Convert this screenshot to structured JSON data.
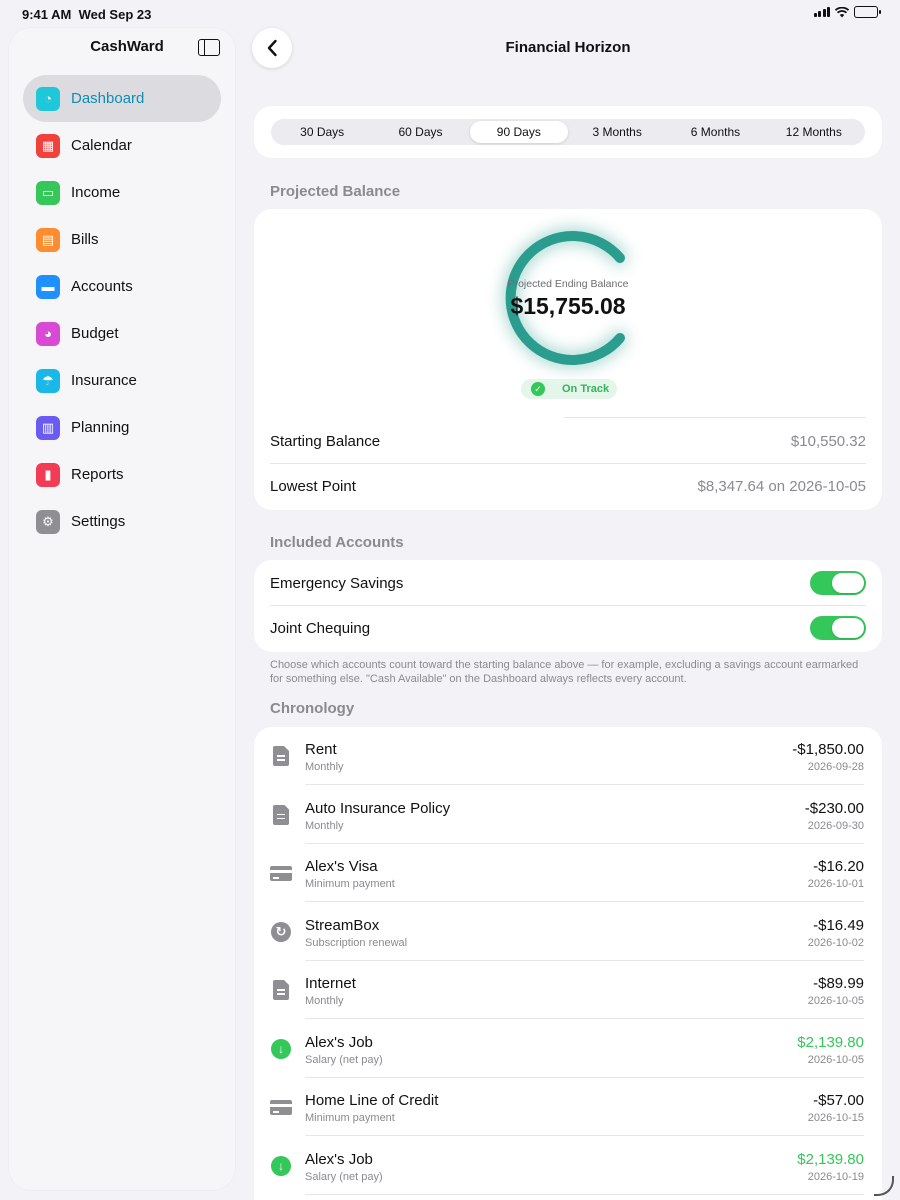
{
  "status_bar": {
    "time": "9:41 AM",
    "date": "Wed Sep 23"
  },
  "sidebar": {
    "title": "CashWard",
    "items": [
      {
        "label": "Dashboard",
        "icon": "gauge-icon",
        "color": "#1ec8d8",
        "active": true
      },
      {
        "label": "Calendar",
        "icon": "calendar-icon",
        "color": "#f2413d"
      },
      {
        "label": "Income",
        "icon": "money-icon",
        "color": "#35c75a"
      },
      {
        "label": "Bills",
        "icon": "document-icon",
        "color": "#ff8c2e"
      },
      {
        "label": "Accounts",
        "icon": "credit-card-icon",
        "color": "#1e90ff"
      },
      {
        "label": "Budget",
        "icon": "pie-chart-icon",
        "color": "#d94ad4"
      },
      {
        "label": "Insurance",
        "icon": "umbrella-icon",
        "color": "#19b8e6"
      },
      {
        "label": "Planning",
        "icon": "map-icon",
        "color": "#6a5cf0"
      },
      {
        "label": "Reports",
        "icon": "bar-chart-icon",
        "color": "#f23b55"
      },
      {
        "label": "Settings",
        "icon": "gear-icon",
        "color": "#8e8e93"
      }
    ]
  },
  "header": {
    "title": "Financial Horizon"
  },
  "ranges": {
    "options": [
      "30 Days",
      "60 Days",
      "90 Days",
      "3 Months",
      "6 Months",
      "12 Months"
    ],
    "selected": "90 Days"
  },
  "projected": {
    "section_label": "Projected Balance",
    "ring_label": "Projected Ending Balance",
    "ending_balance": "$15,755.08",
    "status": "On Track",
    "ring_color": "#2a9d8f",
    "starting_label": "Starting Balance",
    "starting_value": "$10,550.32",
    "lowest_label": "Lowest Point",
    "lowest_value": "$8,347.64 on 2026-10-05"
  },
  "accounts": {
    "section_label": "Included Accounts",
    "items": [
      {
        "name": "Emergency Savings",
        "enabled": true
      },
      {
        "name": "Joint Chequing",
        "enabled": true
      }
    ],
    "footnote": "Choose which accounts count toward the starting balance above — for example, excluding a savings account earmarked for something else. \"Cash Available\" on the Dashboard always reflects every account."
  },
  "chronology": {
    "section_label": "Chronology",
    "items": [
      {
        "name": "Rent",
        "sub": "Monthly",
        "amount": "-$1,850.00",
        "date": "2026-09-28",
        "icon": "document-icon",
        "type": "expense"
      },
      {
        "name": "Auto Insurance Policy",
        "sub": "Monthly",
        "amount": "-$230.00",
        "date": "2026-09-30",
        "icon": "document-icon",
        "type": "expense"
      },
      {
        "name": "Alex's Visa",
        "sub": "Minimum payment",
        "amount": "-$16.20",
        "date": "2026-10-01",
        "icon": "credit-card-icon",
        "type": "expense"
      },
      {
        "name": "StreamBox",
        "sub": "Subscription renewal",
        "amount": "-$16.49",
        "date": "2026-10-02",
        "icon": "renew-icon",
        "type": "expense"
      },
      {
        "name": "Internet",
        "sub": "Monthly",
        "amount": "-$89.99",
        "date": "2026-10-05",
        "icon": "document-icon",
        "type": "expense"
      },
      {
        "name": "Alex's Job",
        "sub": "Salary (net pay)",
        "amount": "$2,139.80",
        "date": "2026-10-05",
        "icon": "income-arrow-icon",
        "type": "income"
      },
      {
        "name": "Home Line of Credit",
        "sub": "Minimum payment",
        "amount": "-$57.00",
        "date": "2026-10-15",
        "icon": "credit-card-icon",
        "type": "expense"
      },
      {
        "name": "Alex's Job",
        "sub": "Salary (net pay)",
        "amount": "$2,139.80",
        "date": "2026-10-19",
        "icon": "income-arrow-icon",
        "type": "income"
      }
    ]
  }
}
